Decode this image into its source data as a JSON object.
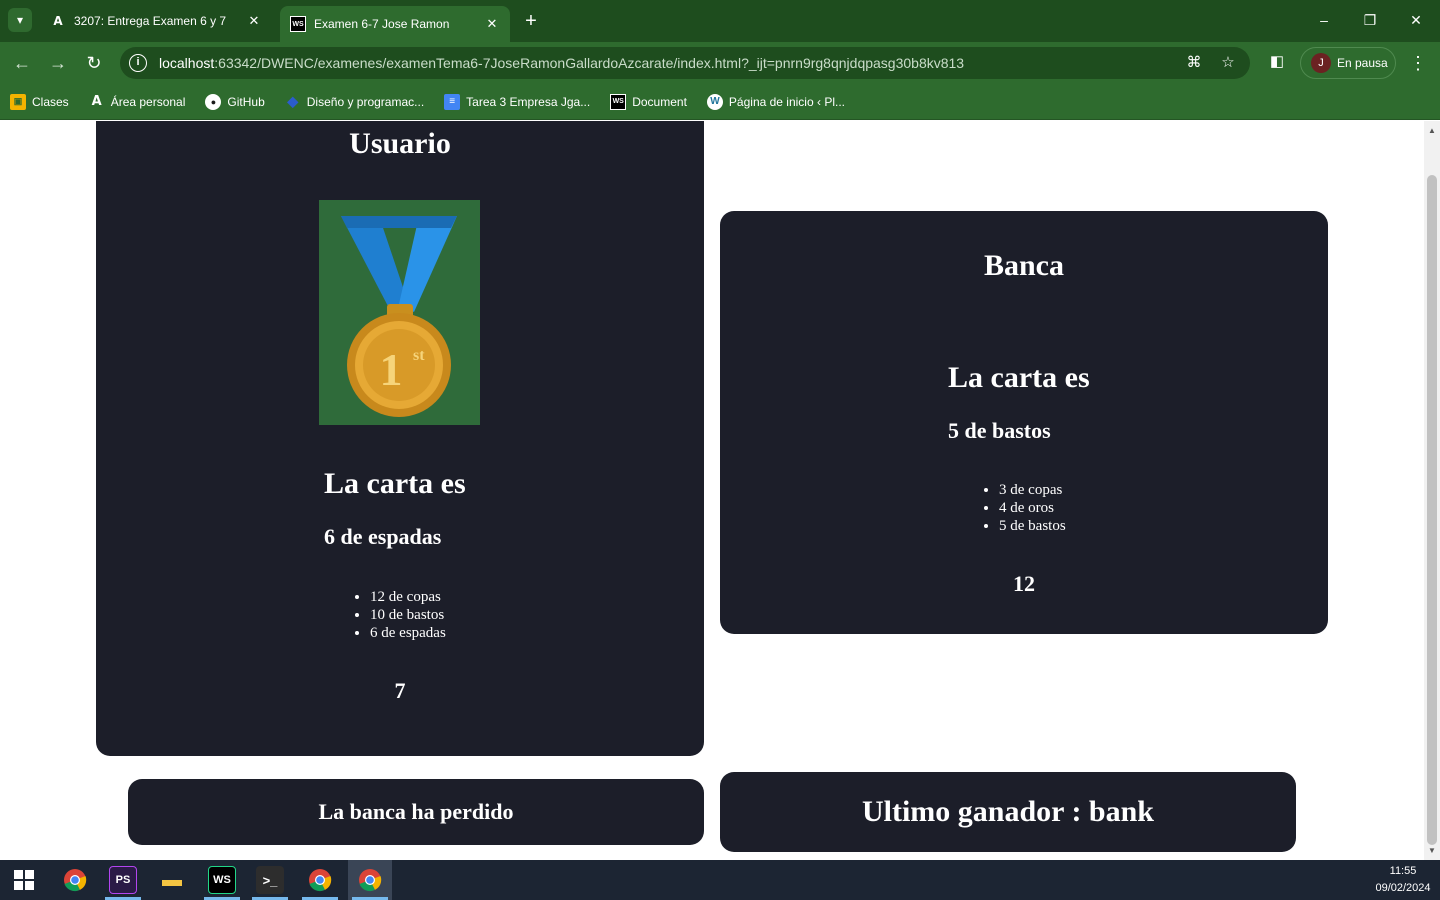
{
  "browser": {
    "tabs": [
      {
        "title": "3207: Entrega Examen 6 y 7",
        "icon": "a-icon",
        "active": false
      },
      {
        "title": "Examen 6-7 Jose Ramon",
        "icon": "ws-icon",
        "active": true
      }
    ],
    "url_host": "localhost",
    "url_rest": ":63342/DWENC/examenes/examenTema6-7JoseRamonGallardoAzcarate/index.html?_ijt=pnrn9rg8qnjdqpasg30b8kv813",
    "profile_initial": "J",
    "profile_status": "En pausa",
    "bookmarks": [
      {
        "label": "Clases",
        "icon": "classroom-icon"
      },
      {
        "label": "Área personal",
        "icon": "a-icon"
      },
      {
        "label": "GitHub",
        "icon": "github-icon"
      },
      {
        "label": "Diseño y programac...",
        "icon": "design-icon"
      },
      {
        "label": "Tarea 3 Empresa Jga...",
        "icon": "docs-icon"
      },
      {
        "label": "Document",
        "icon": "ws-icon"
      },
      {
        "label": "Página de inicio ‹ Pl...",
        "icon": "wordpress-icon"
      }
    ],
    "accent_color": "#2e6b2e"
  },
  "page": {
    "user": {
      "title": "Usuario",
      "carta_label": "La carta es",
      "current_card": "6 de espadas",
      "cards": [
        "12 de copas",
        "10 de bastos",
        "6 de espadas"
      ],
      "total": "7",
      "medal_text": "1st"
    },
    "bank": {
      "title": "Banca",
      "carta_label": "La carta es",
      "current_card": "5 de bastos",
      "cards": [
        "3 de copas",
        "4 de oros",
        "5 de bastos"
      ],
      "total": "12"
    },
    "result": "La banca ha perdido",
    "last_winner": "Ultimo ganador : bank",
    "panel_color": "#1c1e29"
  },
  "taskbar": {
    "time": "11:55",
    "date": "09/02/2024"
  }
}
